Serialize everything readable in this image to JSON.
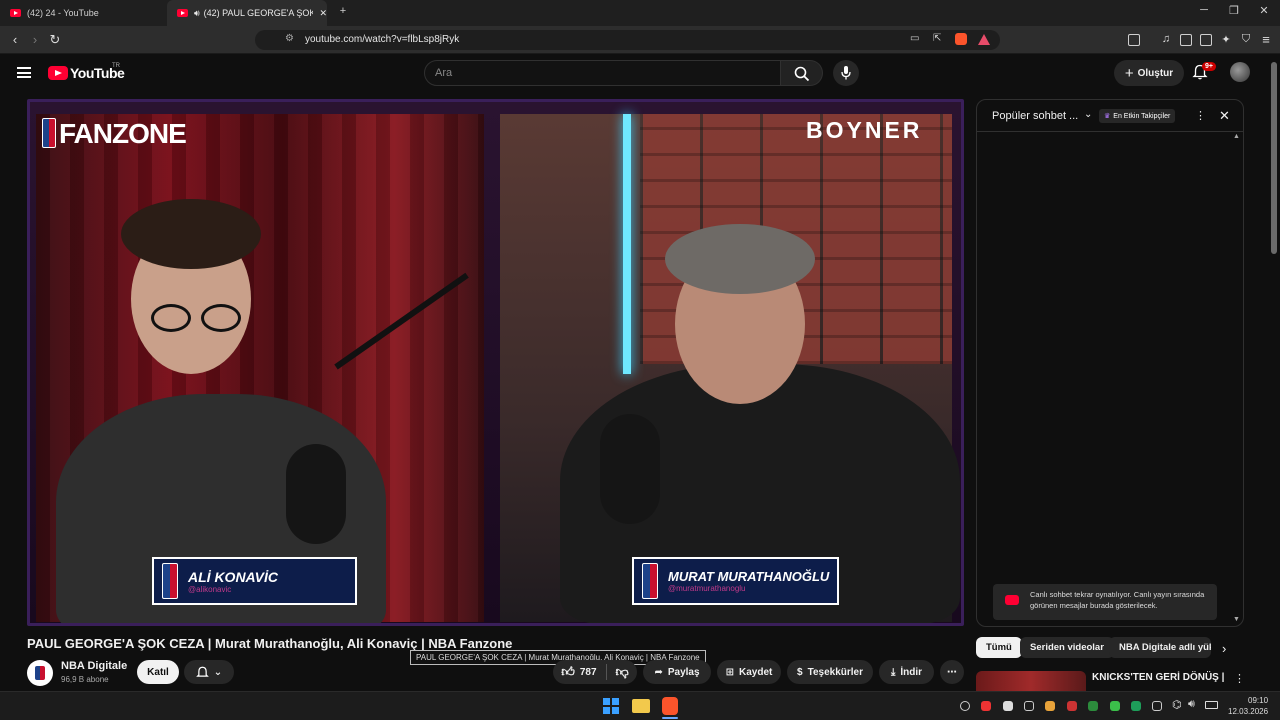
{
  "browser": {
    "tabs": [
      {
        "label": "(42) 24 - YouTube"
      },
      {
        "label": "(42) PAUL GEORGE'A ŞOK CE..."
      }
    ],
    "url": "youtube.com/watch?v=flbLsp8jRyk"
  },
  "header": {
    "logo_text": "YouTube",
    "region": "TR",
    "search_placeholder": "Ara",
    "create_label": "Oluştur",
    "notification_count": "9+"
  },
  "video": {
    "overlay_brand_left": "FANZONE",
    "overlay_brand_right": "BOYNER",
    "lower_third_left": {
      "name": "ALİ KONAVİC",
      "handle": "@alikonavic"
    },
    "lower_third_right": {
      "name": "MURAT MURATHANOĞLU",
      "handle": "@muratmurathanoglu"
    },
    "title": "PAUL GEORGE'A ŞOK CEZA | Murat Murathanoğlu, Ali Konaviç | NBA Fanzone",
    "tooltip": "PAUL GEORGE'A ŞOK CEZA | Murat Murathanoğlu, Ali Konaviç | NBA Fanzone"
  },
  "channel": {
    "name": "NBA Digitale",
    "subscribers": "96,9 B abone",
    "join_label": "Katıl"
  },
  "actions": {
    "like_count": "787",
    "share_label": "Paylaş",
    "save_label": "Kaydet",
    "thanks_label": "Teşekkürler",
    "download_label": "İndir"
  },
  "chat": {
    "title": "Popüler sohbet ...",
    "pill_label": "En Etkin Takipçiler",
    "notice": "Canlı sohbet tekrar oynatılıyor. Canlı yayın sırasında görünen mesajlar burada gösterilecek."
  },
  "recommendations": {
    "chips": [
      "Tümü",
      "Seriden videolar",
      "NBA Digitale adlı yük..."
    ],
    "first_title": "KNICKS'TEN GERİ DÖNÜŞ |"
  },
  "taskbar": {
    "time": "09:10",
    "date": "12.03.2026"
  }
}
